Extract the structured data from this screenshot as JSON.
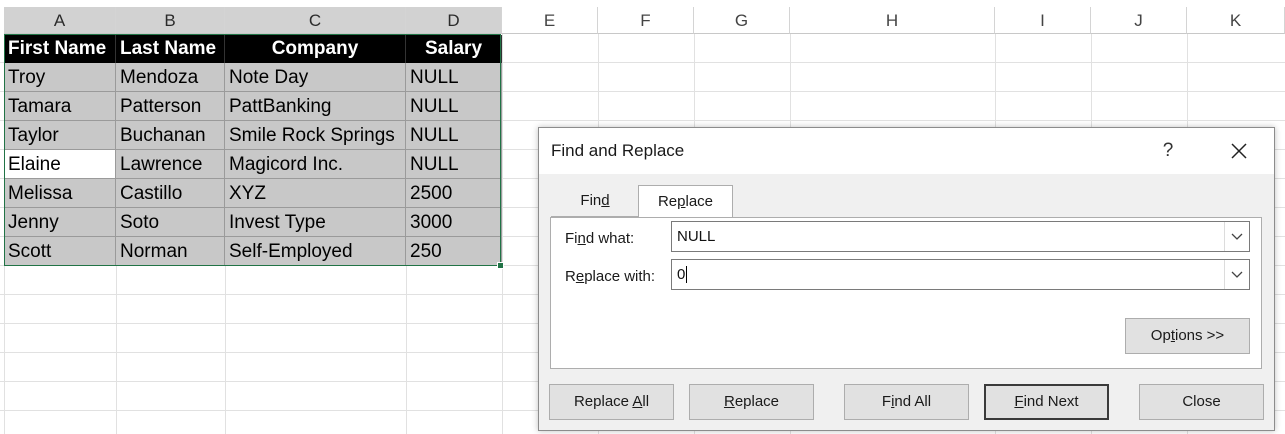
{
  "sheet": {
    "columns": [
      "A",
      "B",
      "C",
      "D",
      "E",
      "F",
      "G",
      "H",
      "I",
      "J",
      "K"
    ],
    "headers": [
      "First Name",
      "Last Name",
      "Company",
      "Salary"
    ],
    "rows": [
      [
        "Troy",
        "Mendoza",
        "Note Day",
        "NULL"
      ],
      [
        "Tamara",
        "Patterson",
        "PattBanking",
        "NULL"
      ],
      [
        "Taylor",
        "Buchanan",
        "Smile Rock Springs",
        "NULL"
      ],
      [
        "Elaine",
        "Lawrence",
        "Magicord Inc.",
        "NULL"
      ],
      [
        "Melissa",
        "Castillo",
        "XYZ",
        "2500"
      ],
      [
        "Jenny",
        "Soto",
        "Invest Type",
        "3000"
      ],
      [
        "Scott",
        "Norman",
        "Self-Employed",
        "250"
      ]
    ],
    "active_cell": "A5",
    "selection_color": "#217346"
  },
  "dialog": {
    "title": "Find and Replace",
    "help_label": "?",
    "tabs": {
      "find": {
        "pre": "Fin",
        "key": "d",
        "post": ""
      },
      "replace": {
        "pre": "Re",
        "key": "p",
        "post": "lace"
      }
    },
    "find_what": {
      "pre": "Fi",
      "key": "n",
      "post": "d what:",
      "value": "NULL"
    },
    "replace_with": {
      "pre": "R",
      "key": "e",
      "post": "place with:",
      "value": "0"
    },
    "options": {
      "pre": "Op",
      "key": "t",
      "post": "ions >>"
    },
    "buttons": {
      "replace_all": {
        "pre": "Replace ",
        "key": "A",
        "post": "ll"
      },
      "replace": {
        "pre": "",
        "key": "R",
        "post": "eplace"
      },
      "find_all": {
        "pre": "F",
        "key": "i",
        "post": "nd All"
      },
      "find_next": {
        "pre": "",
        "key": "F",
        "post": "ind Next"
      },
      "close": {
        "pre": "",
        "key": "",
        "post": "Close"
      }
    }
  }
}
